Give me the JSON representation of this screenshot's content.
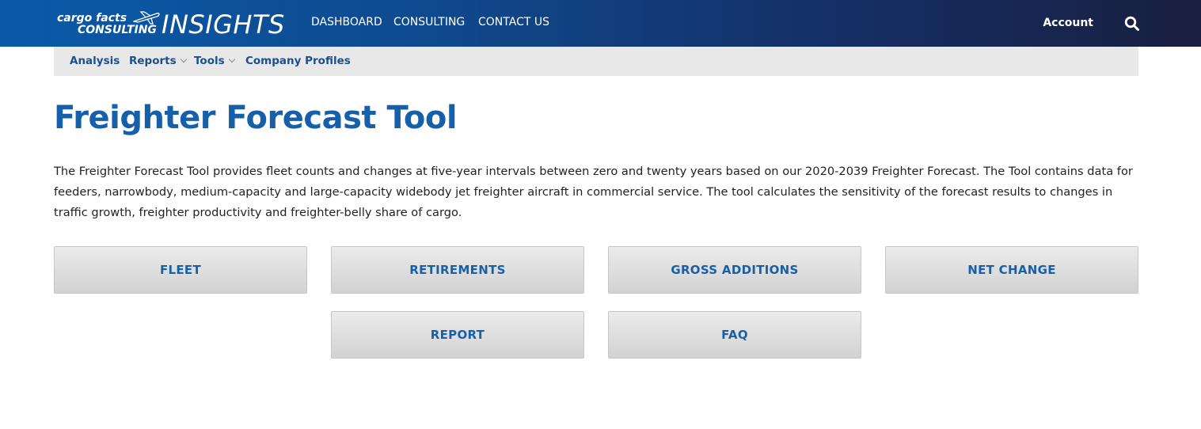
{
  "header": {
    "logo": {
      "line1": "cargo facts",
      "line2": "CONSULTING",
      "brand": "INSIGHTS"
    },
    "nav": [
      {
        "label": "DASHBOARD"
      },
      {
        "label": "CONSULTING"
      },
      {
        "label": "CONTACT US"
      }
    ],
    "account_label": "Account",
    "search_icon": "search-icon"
  },
  "subnav": {
    "items": [
      {
        "label": "Analysis",
        "has_dropdown": false
      },
      {
        "label": "Reports",
        "has_dropdown": true
      },
      {
        "label": "Tools",
        "has_dropdown": true
      },
      {
        "label": "Company Profiles",
        "has_dropdown": false
      }
    ]
  },
  "main": {
    "title": "Freighter Forecast Tool",
    "description": "The Freighter Forecast Tool provides fleet counts and changes at five-year intervals between zero and twenty years based on our 2020-2039 Freighter Forecast. The Tool contains data for feeders, narrowbody, medium-capacity and large-capacity widebody jet freighter aircraft in commercial service. The tool calculates the sensitivity of the forecast results to changes in traffic growth, freighter productivity and freighter-belly share of cargo.",
    "buttons": [
      {
        "label": "FLEET"
      },
      {
        "label": "RETIREMENTS"
      },
      {
        "label": "GROSS ADDITIONS"
      },
      {
        "label": "NET CHANGE"
      },
      {
        "label": "REPORT"
      },
      {
        "label": "FAQ"
      }
    ]
  },
  "colors": {
    "header_gradient_start": "#0a5aa8",
    "header_gradient_end": "#191f3f",
    "title_blue": "#1660a9",
    "subnav_text": "#1d4f8c",
    "subnav_bg": "#e8e8e8",
    "button_bg": "#d9d9d9"
  }
}
